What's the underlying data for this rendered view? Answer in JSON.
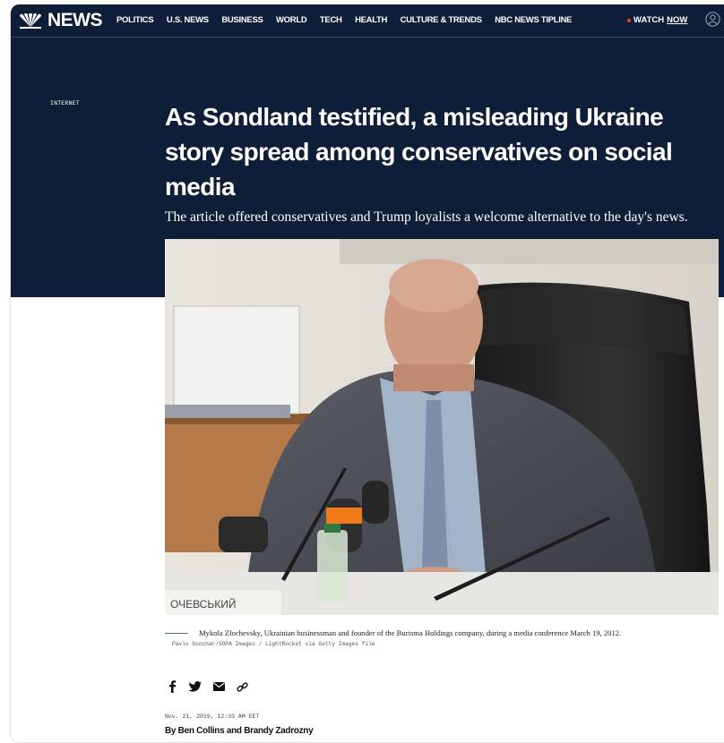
{
  "brand": {
    "name": "NEWS"
  },
  "nav": {
    "items": [
      {
        "label": "POLITICS"
      },
      {
        "label": "U.S. NEWS"
      },
      {
        "label": "BUSINESS"
      },
      {
        "label": "WORLD"
      },
      {
        "label": "TECH"
      },
      {
        "label": "HEALTH"
      },
      {
        "label": "CULTURE & TRENDS"
      },
      {
        "label": "NBC NEWS TIPLINE"
      }
    ],
    "watch_label": "WATCH",
    "watch_now": "NOW"
  },
  "article": {
    "section": "INTERNET",
    "headline": "As Sondland testified, a misleading Ukraine story spread among conservatives on social media",
    "dek": "The article offered conservatives and Trump loyalists a welcome alternative to the day's news.",
    "caption": "Mykola Zlochevsky, Ukrainian businessman and founder of the Burisma Holdings company, during a media conference March 19, 2012.",
    "credit": "Pavlo Gonchar/SOPA Images / LightRocket via Getty Images file",
    "timestamp": "Nov. 21, 2019, 12:33 AM EET",
    "byline": "By Ben Collins and Brandy Zadrozny",
    "nameplate_text": "ОЧЕВСЬКИЙ"
  },
  "share": {
    "icons": [
      "facebook-icon",
      "twitter-icon",
      "email-icon",
      "link-icon"
    ]
  },
  "colors": {
    "hero_background": "#0f1e38",
    "live_dot": "#e8423a",
    "caption_rule": "#4a6fa8"
  }
}
